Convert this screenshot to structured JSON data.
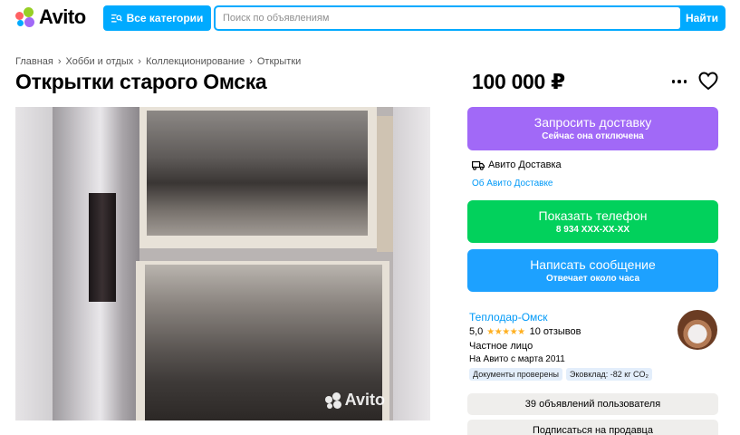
{
  "header": {
    "logo_text": "Avito",
    "categories_label": "Все категории",
    "search_placeholder": "Поиск по объявлениям",
    "search_button": "Найти",
    "colors": {
      "accent": "#00aaff",
      "logo_dots": [
        "#00aaff",
        "#97cf26",
        "#a169f7",
        "#ff6163"
      ]
    }
  },
  "breadcrumb": [
    "Главная",
    "Хобби и отдых",
    "Коллекционирование",
    "Открытки"
  ],
  "listing": {
    "title": "Открытки старого Омска",
    "price": "100 000 ₽",
    "photo_watermark": "Avito"
  },
  "actions": {
    "delivery_label": "Запросить доставку",
    "delivery_sub": "Сейчас она отключена",
    "avito_delivery": "Авито Доставка",
    "about_delivery": "Об Авито Доставке",
    "phone_label": "Показать телефон",
    "phone_number": "8 934 XXX-XX-XX",
    "message_label": "Написать сообщение",
    "message_sub": "Отвечает около часа"
  },
  "seller": {
    "name": "Теплодар-Омск",
    "rating": "5,0",
    "stars": "★★★★★",
    "reviews": "10 отзывов",
    "type": "Частное лицо",
    "since": "На Авито с марта 2011",
    "badges": [
      "Документы проверены",
      "Эковклад: -82 кг CO₂"
    ],
    "ads_count": "39 объявлений пользователя",
    "subscribe": "Подписаться на продавца"
  }
}
